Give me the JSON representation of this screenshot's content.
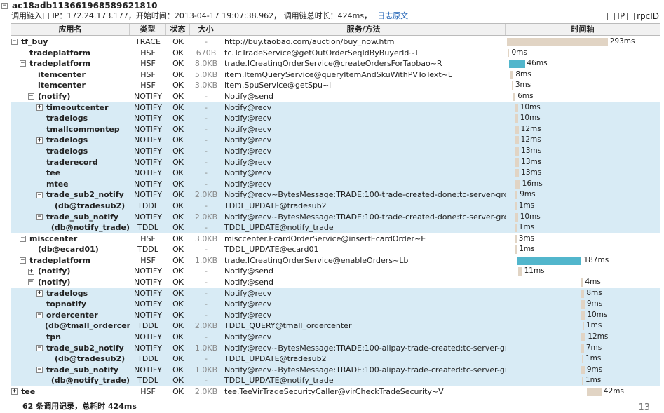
{
  "header": {
    "trace_id": "ac18adb113661968589621810",
    "meta_text": "调用链入口 IP：172.24.173.177，开始时间：2013-04-17 19:07:38.962， 调用链总时长：424ms，",
    "log_link": "日志原文",
    "opt_ip": "IP",
    "opt_rpcid": "rpcID"
  },
  "columns": {
    "app": "应用名",
    "type": "类型",
    "status": "状态",
    "size": "大小",
    "service": "服务/方法",
    "timeline": "时间轴"
  },
  "timeline_scale": {
    "total_ms": 424
  },
  "rows": [
    {
      "indent": 0,
      "toggle": "-",
      "name": "tf_buy",
      "type": "TRACE",
      "status": "OK",
      "size": "-",
      "service": "http://buy.taobao.com/auction/buy_now.htm",
      "start": 0,
      "dur": 293,
      "dur_label": "293ms",
      "hl": false,
      "color": "tan"
    },
    {
      "indent": 1,
      "toggle": "",
      "name": "tradeplatform",
      "type": "HSF",
      "status": "OK",
      "size": "670B",
      "service": "tc.TcTradeService@getOutOrderSeqIdByBuyerId~l",
      "start": 3,
      "dur": 0.5,
      "dur_label": "0ms",
      "hl": false,
      "color": "tan"
    },
    {
      "indent": 1,
      "toggle": "-",
      "name": "tradeplatform",
      "type": "HSF",
      "status": "OK",
      "size": "8.0KB",
      "service": "trade.ICreatingOrderService@createOrdersForTaobao~R",
      "start": 6,
      "dur": 46,
      "dur_label": "46ms",
      "hl": false,
      "color": "blue"
    },
    {
      "indent": 2,
      "toggle": "",
      "name": "itemcenter",
      "type": "HSF",
      "status": "OK",
      "size": "5.0KB",
      "service": "item.ItemQueryService@queryItemAndSkuWithPVToText~L",
      "start": 11,
      "dur": 8,
      "dur_label": "8ms",
      "hl": false,
      "color": "tan"
    },
    {
      "indent": 2,
      "toggle": "",
      "name": "itemcenter",
      "type": "HSF",
      "status": "OK",
      "size": "3.0KB",
      "service": "item.SpuService@getSpu~l",
      "start": 14,
      "dur": 3,
      "dur_label": "3ms",
      "hl": false,
      "color": "tan"
    },
    {
      "indent": 2,
      "toggle": "-",
      "name": "(notify)",
      "type": "NOTIFY",
      "status": "OK",
      "size": "-",
      "service": "Notify@send",
      "start": 19,
      "dur": 6,
      "dur_label": "6ms",
      "hl": false,
      "color": "tan"
    },
    {
      "indent": 3,
      "toggle": "+",
      "name": "timeoutcenter",
      "type": "NOTIFY",
      "status": "OK",
      "size": "-",
      "service": "Notify@recv",
      "start": 22,
      "dur": 10,
      "dur_label": "10ms",
      "hl": true,
      "color": "tan"
    },
    {
      "indent": 3,
      "toggle": "",
      "name": "tradelogs",
      "type": "NOTIFY",
      "status": "OK",
      "size": "-",
      "service": "Notify@recv",
      "start": 22,
      "dur": 10,
      "dur_label": "10ms",
      "hl": true,
      "color": "tan"
    },
    {
      "indent": 3,
      "toggle": "",
      "name": "tmallcommontep",
      "type": "NOTIFY",
      "status": "OK",
      "size": "-",
      "service": "Notify@recv",
      "start": 22,
      "dur": 12,
      "dur_label": "12ms",
      "hl": true,
      "color": "tan"
    },
    {
      "indent": 3,
      "toggle": "+",
      "name": "tradelogs",
      "type": "NOTIFY",
      "status": "OK",
      "size": "-",
      "service": "Notify@recv",
      "start": 22,
      "dur": 12,
      "dur_label": "12ms",
      "hl": true,
      "color": "tan"
    },
    {
      "indent": 3,
      "toggle": "",
      "name": "tradelogs",
      "type": "NOTIFY",
      "status": "OK",
      "size": "-",
      "service": "Notify@recv",
      "start": 22,
      "dur": 13,
      "dur_label": "13ms",
      "hl": true,
      "color": "tan"
    },
    {
      "indent": 3,
      "toggle": "",
      "name": "traderecord",
      "type": "NOTIFY",
      "status": "OK",
      "size": "-",
      "service": "Notify@recv",
      "start": 22,
      "dur": 13,
      "dur_label": "13ms",
      "hl": true,
      "color": "tan"
    },
    {
      "indent": 3,
      "toggle": "",
      "name": "tee",
      "type": "NOTIFY",
      "status": "OK",
      "size": "-",
      "service": "Notify@recv",
      "start": 22,
      "dur": 13,
      "dur_label": "13ms",
      "hl": true,
      "color": "tan"
    },
    {
      "indent": 3,
      "toggle": "",
      "name": "mtee",
      "type": "NOTIFY",
      "status": "OK",
      "size": "-",
      "service": "Notify@recv",
      "start": 22,
      "dur": 16,
      "dur_label": "16ms",
      "hl": true,
      "color": "tan"
    },
    {
      "indent": 3,
      "toggle": "-",
      "name": "trade_sub2_notify",
      "type": "NOTIFY",
      "status": "OK",
      "size": "2.0KB",
      "service": "Notify@recv~BytesMessage:TRADE:100-trade-created-done:tc-server-group-2",
      "start": 22,
      "dur": 9,
      "dur_label": "9ms",
      "hl": true,
      "color": "tan"
    },
    {
      "indent": 4,
      "toggle": "",
      "name": "(db@tradesub2)",
      "type": "TDDL",
      "status": "OK",
      "size": "-",
      "service": "TDDL_UPDATE@tradesub2",
      "start": 24,
      "dur": 1,
      "dur_label": "1ms",
      "hl": true,
      "color": "tan"
    },
    {
      "indent": 3,
      "toggle": "-",
      "name": "trade_sub_notify",
      "type": "NOTIFY",
      "status": "OK",
      "size": "2.0KB",
      "service": "Notify@recv~BytesMessage:TRADE:100-trade-created-done:tc-server-group-2",
      "start": 22,
      "dur": 10,
      "dur_label": "10ms",
      "hl": true,
      "color": "tan"
    },
    {
      "indent": 4,
      "toggle": "",
      "name": "(db@notify_trade)",
      "type": "TDDL",
      "status": "OK",
      "size": "-",
      "service": "TDDL_UPDATE@notify_trade",
      "start": 24,
      "dur": 1,
      "dur_label": "1ms",
      "hl": true,
      "color": "tan"
    },
    {
      "indent": 1,
      "toggle": "-",
      "name": "misccenter",
      "type": "HSF",
      "status": "OK",
      "size": "3.0KB",
      "service": "misccenter.EcardOrderService@insertEcardOrder~E",
      "start": 24,
      "dur": 3,
      "dur_label": "3ms",
      "hl": false,
      "color": "tan"
    },
    {
      "indent": 2,
      "toggle": "",
      "name": "(db@ecard01)",
      "type": "TDDL",
      "status": "OK",
      "size": "-",
      "service": "TDDL_UPDATE@ecard01",
      "start": 25,
      "dur": 1,
      "dur_label": "1ms",
      "hl": false,
      "color": "tan"
    },
    {
      "indent": 1,
      "toggle": "-",
      "name": "tradeplatform",
      "type": "HSF",
      "status": "OK",
      "size": "1.0KB",
      "service": "trade.ICreatingOrderService@enableOrders~Lb",
      "start": 30,
      "dur": 187,
      "dur_label": "187ms",
      "hl": false,
      "color": "blue"
    },
    {
      "indent": 2,
      "toggle": "+",
      "name": "(notify)",
      "type": "NOTIFY",
      "status": "OK",
      "size": "-",
      "service": "Notify@send",
      "start": 33,
      "dur": 11,
      "dur_label": "11ms",
      "hl": false,
      "color": "tan"
    },
    {
      "indent": 2,
      "toggle": "-",
      "name": "(notify)",
      "type": "NOTIFY",
      "status": "OK",
      "size": "-",
      "service": "Notify@send",
      "start": 217,
      "dur": 4,
      "dur_label": "4ms",
      "hl": false,
      "color": "tan"
    },
    {
      "indent": 3,
      "toggle": "+",
      "name": "tradelogs",
      "type": "NOTIFY",
      "status": "OK",
      "size": "-",
      "service": "Notify@recv",
      "start": 217,
      "dur": 8,
      "dur_label": "8ms",
      "hl": true,
      "color": "tan"
    },
    {
      "indent": 3,
      "toggle": "",
      "name": "topnotify",
      "type": "NOTIFY",
      "status": "OK",
      "size": "-",
      "service": "Notify@recv",
      "start": 217,
      "dur": 9,
      "dur_label": "9ms",
      "hl": true,
      "color": "tan"
    },
    {
      "indent": 3,
      "toggle": "-",
      "name": "ordercenter",
      "type": "NOTIFY",
      "status": "OK",
      "size": "-",
      "service": "Notify@recv",
      "start": 217,
      "dur": 10,
      "dur_label": "10ms",
      "hl": true,
      "color": "tan"
    },
    {
      "indent": 4,
      "toggle": "",
      "name": "(db@tmall_ordercer",
      "type": "TDDL",
      "status": "OK",
      "size": "2.0KB",
      "service": "TDDL_QUERY@tmall_ordercenter",
      "start": 220,
      "dur": 1,
      "dur_label": "1ms",
      "hl": true,
      "color": "tan"
    },
    {
      "indent": 3,
      "toggle": "",
      "name": "tpn",
      "type": "NOTIFY",
      "status": "OK",
      "size": "-",
      "service": "Notify@recv",
      "start": 217,
      "dur": 12,
      "dur_label": "12ms",
      "hl": true,
      "color": "tan"
    },
    {
      "indent": 3,
      "toggle": "-",
      "name": "trade_sub2_notify",
      "type": "NOTIFY",
      "status": "OK",
      "size": "1.0KB",
      "service": "Notify@recv~BytesMessage:TRADE:100-alipay-trade-created:tc-server-group-2",
      "start": 217,
      "dur": 7,
      "dur_label": "7ms",
      "hl": true,
      "color": "tan"
    },
    {
      "indent": 4,
      "toggle": "",
      "name": "(db@tradesub2)",
      "type": "TDDL",
      "status": "OK",
      "size": "-",
      "service": "TDDL_UPDATE@tradesub2",
      "start": 218,
      "dur": 1,
      "dur_label": "1ms",
      "hl": true,
      "color": "tan"
    },
    {
      "indent": 3,
      "toggle": "-",
      "name": "trade_sub_notify",
      "type": "NOTIFY",
      "status": "OK",
      "size": "1.0KB",
      "service": "Notify@recv~BytesMessage:TRADE:100-alipay-trade-created:tc-server-group-2",
      "start": 217,
      "dur": 9,
      "dur_label": "9ms",
      "hl": true,
      "color": "tan"
    },
    {
      "indent": 4,
      "toggle": "",
      "name": "(db@notify_trade)",
      "type": "TDDL",
      "status": "OK",
      "size": "-",
      "service": "TDDL_UPDATE@notify_trade",
      "start": 218,
      "dur": 1,
      "dur_label": "1ms",
      "hl": true,
      "color": "tan"
    },
    {
      "indent": 0,
      "toggle": "+",
      "name": "tee",
      "type": "HSF",
      "status": "OK",
      "size": "2.0KB",
      "service": "tee.TeeVirTradeSecurityCaller@virCheckTradeSecurity~V",
      "start": 233,
      "dur": 42,
      "dur_label": "42ms",
      "hl": false,
      "color": "tan"
    }
  ],
  "footer": {
    "summary": "62 条调用记录，总耗时 424ms"
  },
  "page_number": "13"
}
